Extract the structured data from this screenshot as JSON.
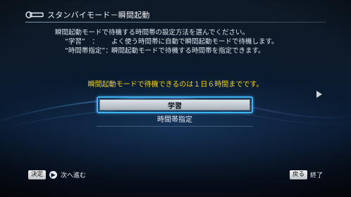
{
  "header": {
    "icon": "standby-remote-icon",
    "title": "スタンバイモード－瞬間起動"
  },
  "description": {
    "intro": "瞬間起動モードで待機する時間帯の設定方法を選んでください。",
    "items": [
      {
        "term": "“学習”　：",
        "text": "よく使う時間帯に自動で瞬間起動モードで待機します。"
      },
      {
        "term": "“時間帯指定”：",
        "text": "瞬間起動モードで待機する時間帯を指定できます。"
      }
    ]
  },
  "notice": "瞬間起動モードで待機できるのは１日６時間までです。",
  "options": [
    {
      "label": "学習",
      "selected": true
    },
    {
      "label": "時間帯指定",
      "selected": false
    }
  ],
  "footer": {
    "confirm_key": "決定",
    "confirm_label": "次へ進む",
    "back_key": "戻る",
    "back_label": "終了"
  },
  "colors": {
    "accent": "#3fb3f0",
    "notice": "#f0d21a"
  }
}
